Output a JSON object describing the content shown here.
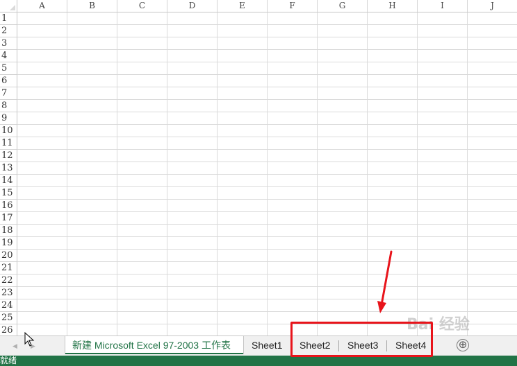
{
  "columns": [
    "A",
    "B",
    "C",
    "D",
    "E",
    "F",
    "G",
    "H",
    "I",
    "J"
  ],
  "rows": [
    "1",
    "2",
    "3",
    "4",
    "5",
    "6",
    "7",
    "8",
    "9",
    "10",
    "11",
    "12",
    "13",
    "14",
    "15",
    "16",
    "17",
    "18",
    "19",
    "20",
    "21",
    "22",
    "23",
    "24",
    "25",
    "26"
  ],
  "tabs": [
    {
      "label": "新建 Microsoft Excel 97-2003 工作表",
      "active": true
    },
    {
      "label": "Sheet1",
      "active": false
    },
    {
      "label": "Sheet2",
      "active": false
    },
    {
      "label": "Sheet3",
      "active": false
    },
    {
      "label": "Sheet4",
      "active": false
    }
  ],
  "add_sheet_icon": "⊕",
  "status": {
    "text": "就绪"
  },
  "colors": {
    "accent": "#217346",
    "annotation": "#e8141b"
  },
  "watermark": "Bai 经验"
}
